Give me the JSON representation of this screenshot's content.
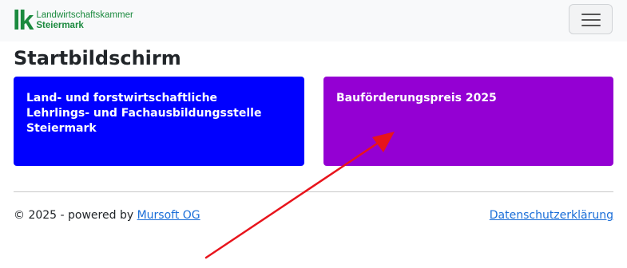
{
  "logo": {
    "mark": "lk",
    "line1": "Landwirtschaftskammer",
    "line2": "Steiermark"
  },
  "nav": {
    "menu_icon": "hamburger-menu-icon"
  },
  "page": {
    "title": "Startbildschirm"
  },
  "cards": [
    {
      "label": "Land- und forstwirtschaftliche\nLehrlings- und Fachausbildungsstelle\nSteiermark",
      "color": "#0000ff"
    },
    {
      "label": "Bauförderungspreis 2025",
      "color": "#9400d3"
    }
  ],
  "footer": {
    "copyright": "© 2025 - powered by ",
    "company_link": "Mursoft OG",
    "privacy_link": "Datenschutzerklärung"
  },
  "annotation": {
    "arrow_color": "#e8141c",
    "icon": "red-arrow-annotation-icon"
  },
  "colors": {
    "brand_green": "#1b8a3e",
    "link_blue": "#1a6ed8"
  }
}
